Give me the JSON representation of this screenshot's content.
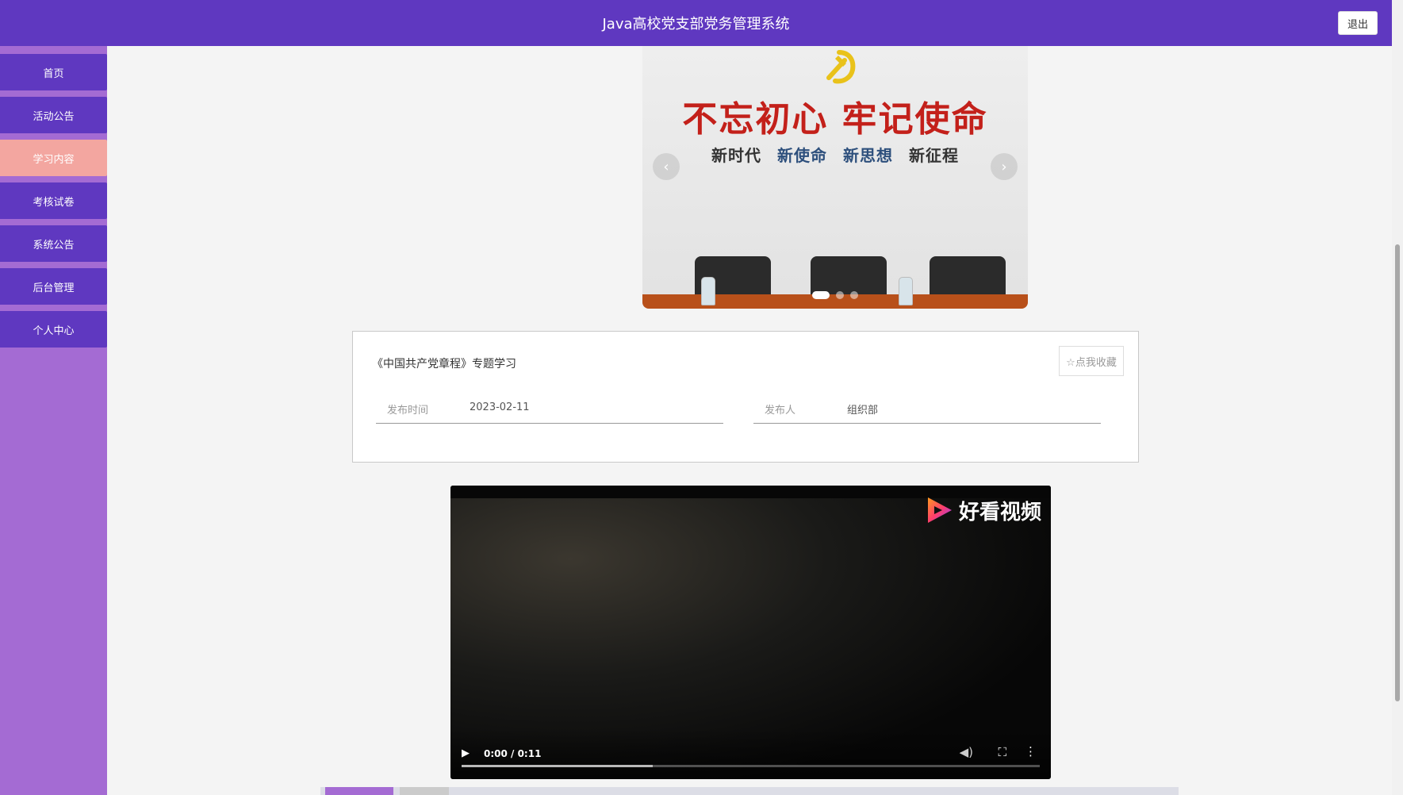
{
  "app": {
    "title": "Java高校党支部党务管理系统",
    "logout_label": "退出"
  },
  "sidebar": {
    "items": [
      {
        "label": "首页"
      },
      {
        "label": "活动公告"
      },
      {
        "label": "学习内容",
        "active": true
      },
      {
        "label": "考核试卷"
      },
      {
        "label": "系统公告"
      },
      {
        "label": "后台管理"
      },
      {
        "label": "个人中心"
      }
    ]
  },
  "carousel": {
    "slogan": "不忘初心 牢记使命",
    "subtitles": [
      "新时代",
      "新使命",
      "新思想",
      "新征程"
    ],
    "prev_icon": "‹",
    "next_icon": "›",
    "slide_count": 3,
    "active_index": 0
  },
  "article": {
    "title": "《中国共产党章程》专题学习",
    "favorite_label": "☆点我收藏",
    "publish_time_label": "发布时间",
    "publish_time": "2023-02-11",
    "publisher_label": "发布人",
    "publisher": "组织部"
  },
  "video": {
    "brand": "好看视频",
    "time": "0:00 / 0:11",
    "buffered_fraction": 0.33
  },
  "colors": {
    "primary": "#5f38c0",
    "sidebar_bg": "#a46bd3",
    "active_item": "#f3a6a0"
  }
}
